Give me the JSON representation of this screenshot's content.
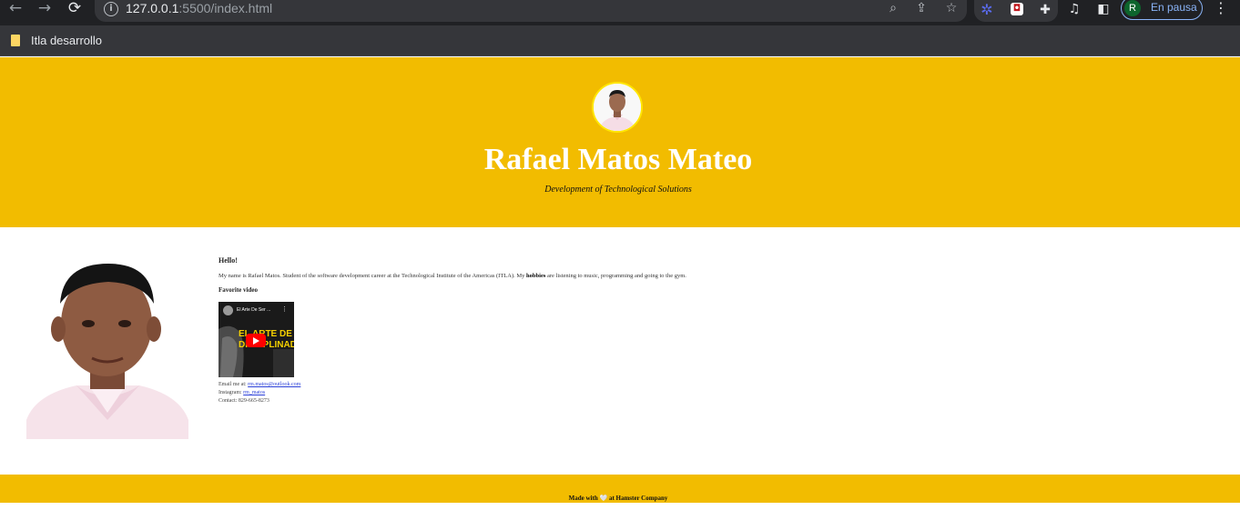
{
  "browser": {
    "url_host": "127.0.0.1",
    "url_path": ":5500/index.html",
    "profile_initial": "R",
    "profile_status": "En pausa",
    "bookmark_label": "Itla desarrollo"
  },
  "header": {
    "title": "Rafael Matos Mateo",
    "subtitle": "Development of Technological Solutions"
  },
  "content": {
    "greeting": "Hello!",
    "about_before": "My name is Rafael Matos. Student of the software development career at the Technological Institute of the Americas (ITLA). My ",
    "about_bold": "hobbies",
    "about_after": " are listening to music, programming and going to the gym.",
    "video_heading": "Favorite video",
    "video": {
      "title": "El Arte De Ser ...",
      "thumb_line1": "EL ARTE DE S",
      "thumb_line2": "DISCIPLINAD"
    },
    "email_label": "Email me at: ",
    "email": "rm.matos@outlook.com",
    "instagram_label": "Instagram: ",
    "instagram": "rm_matos",
    "contact": "Contact: 829-665-8273"
  },
  "footer": {
    "text": "Made with 🤍 at Hamster Company"
  },
  "colors": {
    "brand_yellow": "#f2bc00",
    "avatar_ring": "#ffe600"
  }
}
